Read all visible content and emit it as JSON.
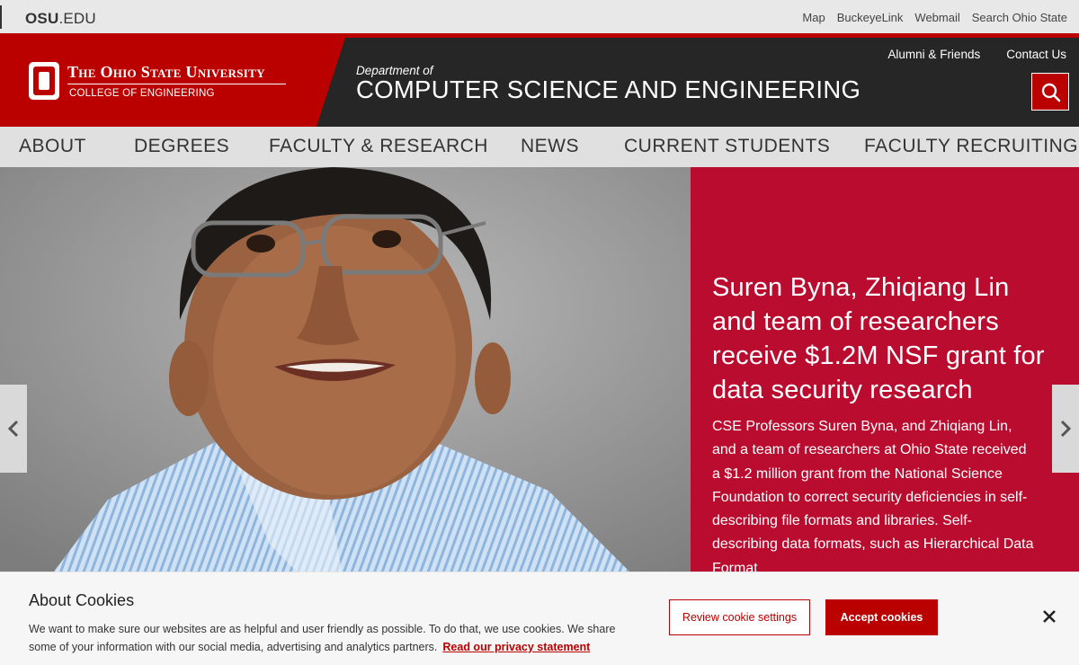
{
  "utility_bar": {
    "osu_bold": "OSU",
    "osu_rest": ".EDU",
    "links": [
      "Map",
      "BuckeyeLink",
      "Webmail",
      "Search Ohio State"
    ]
  },
  "header": {
    "university": "The Ohio State University",
    "college": "COLLEGE OF ENGINEERING",
    "dept_prefix": "Department of",
    "dept_name": "COMPUTER SCIENCE AND ENGINEERING",
    "links": [
      "Alumni & Friends",
      "Contact Us"
    ],
    "search_icon": "search-icon",
    "brand_red": "#bb0000",
    "dark": "#262626"
  },
  "nav": {
    "items": [
      "ABOUT",
      "DEGREES",
      "FACULTY & RESEARCH",
      "NEWS",
      "CURRENT STUDENTS",
      "FACULTY RECRUITING"
    ]
  },
  "hero": {
    "title": "Suren Byna, Zhiqiang Lin and team of researchers receive $1.2M NSF grant for data security research",
    "body": "CSE Professors Suren Byna, and Zhiqiang Lin, and a team of researchers at Ohio State received a $1.2 million grant from the National Science Foundation to correct security deficiencies in self-describing file formats and libraries. Self-describing data formats, such as Hierarchical Data Format",
    "prev_icon": "chevron-left-icon",
    "next_icon": "chevron-right-icon",
    "panel_color": "#ba0c2f"
  },
  "cookie_banner": {
    "title": "About Cookies",
    "text": "We want to make sure our websites are as helpful and user friendly as possible. To do that, we use cookies. We share some of your information with our social media, advertising and analytics partners.",
    "privacy_link": "Read our privacy statement",
    "review_label": "Review cookie settings",
    "accept_label": "Accept cookies",
    "close_icon": "close-icon"
  }
}
